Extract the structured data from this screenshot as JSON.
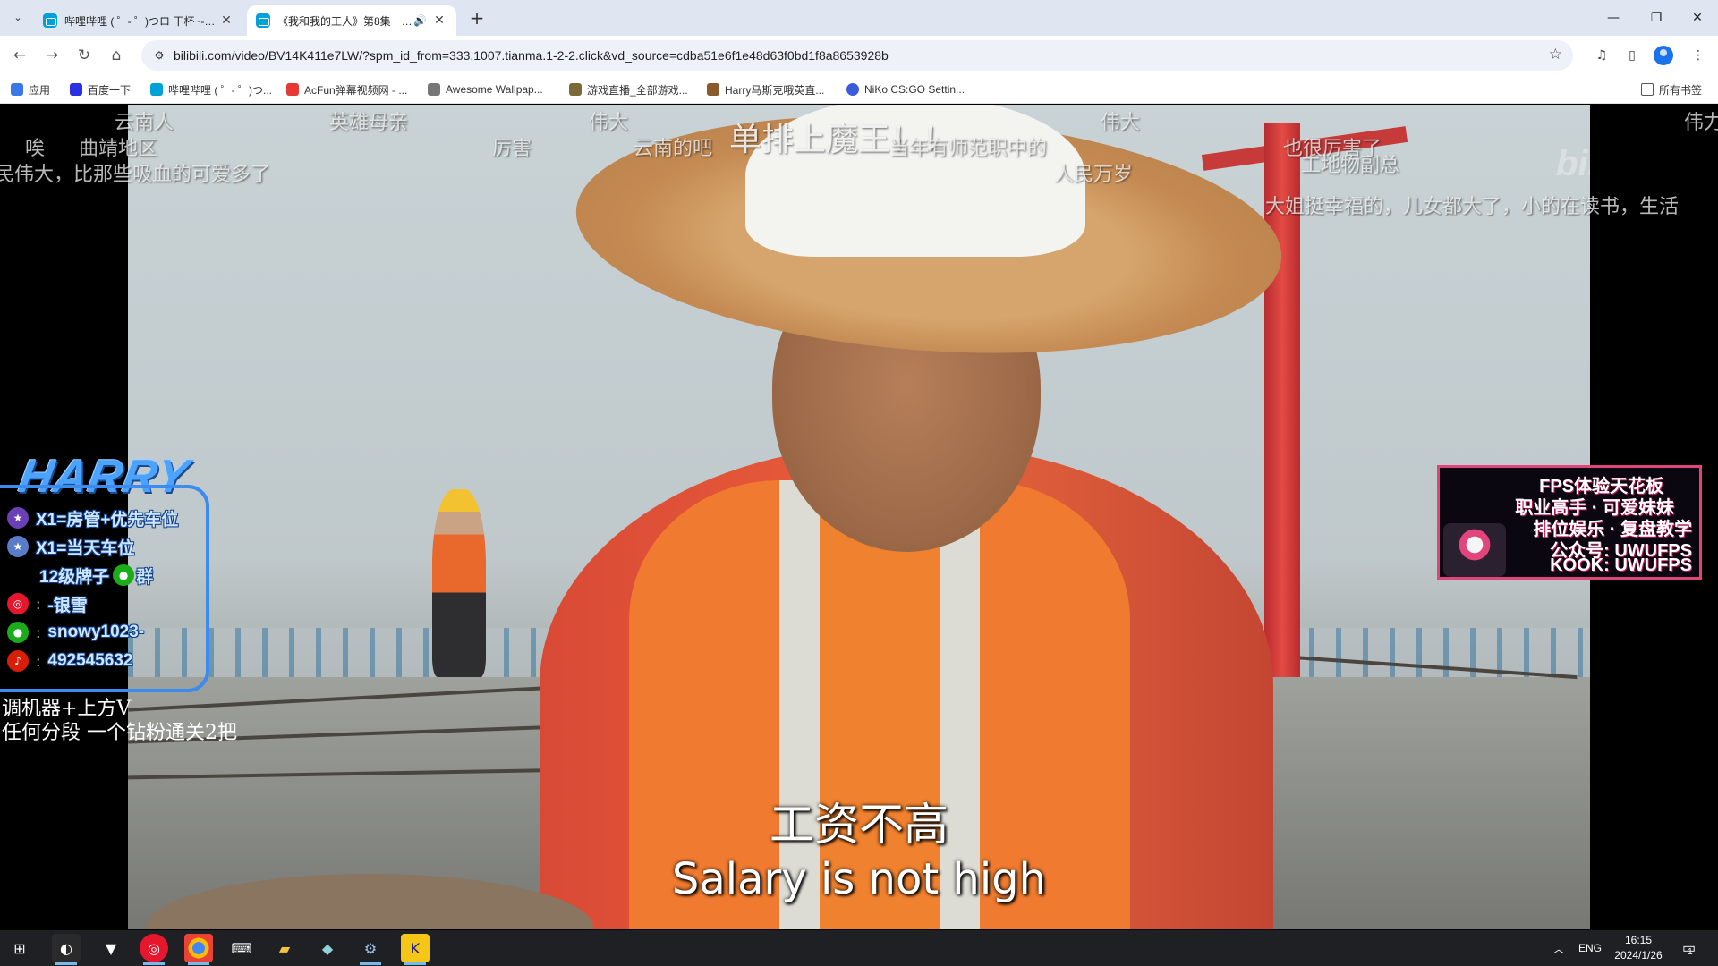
{
  "browser": {
    "tabs": [
      {
        "title": "哔哩哔哩 ( ゜- ゜)つロ 干杯~-bilibili",
        "close": "✕"
      },
      {
        "title": "《我和我的工人》第8集一…",
        "close": "✕",
        "audio": "🔊"
      }
    ],
    "new_tab": "+",
    "window_controls": {
      "minimize": "—",
      "restore": "❐",
      "close": "✕"
    },
    "url": "bilibili.com/video/BV14K411e7LW/?spm_id_from=333.1007.tianma.1-2-2.click&vd_source=cdba51e6f1e48d63f0bd1f8a8653928b",
    "bookmarks": [
      {
        "label": "应用",
        "color": "#3b78e7"
      },
      {
        "label": "百度一下",
        "color": "#2932e1"
      },
      {
        "label": "哔哩哔哩 ( ゜- ゜)つ...",
        "color": "#00a1d6"
      },
      {
        "label": "AcFun弹幕视频网 - ...",
        "color": "#e53935"
      },
      {
        "label": "Awesome Wallpap...",
        "color": "#777777"
      },
      {
        "label": "游戏直播_全部游戏...",
        "color": "#7a6a3a"
      },
      {
        "label": "Harry马斯克哦英直...",
        "color": "#8a5a2a"
      },
      {
        "label": "NiKo CS:GO Settin...",
        "color": "#3b5bdb"
      }
    ],
    "all_bookmarks": "所有书签"
  },
  "video": {
    "danmaku": [
      "云南人",
      "英雄母亲",
      "伟大",
      "伟大",
      "伟力",
      "唉",
      "曲靖地区",
      "厉害",
      "云南的吧",
      "单排上魔王！！",
      "当年有师范职中的",
      "也很厉害了",
      "民伟大，比那些吸血的可爱多了",
      "人民万岁",
      "工地物副总",
      "大姐挺幸福的，儿女都大了，小的在读书，生活"
    ],
    "watermark": "bilibili",
    "subtitle_cn": "工资不高",
    "subtitle_en": "Salary is not high"
  },
  "overlay_left": {
    "logo": "HARRY",
    "rows": [
      {
        "icon": "badge-icon",
        "text": "X1=房管+优先车位",
        "color": "#6b3fb6"
      },
      {
        "icon": "badge-icon",
        "text": "X1=当天车位",
        "color": "#5a7cc8"
      },
      {
        "icon": "wechat-icon",
        "text": "12级牌子",
        "extra": "群",
        "color": "#1aad19"
      },
      {
        "icon": "weibo-icon",
        "text": "-银雪",
        "colon": ":",
        "color": "#e6162d"
      },
      {
        "icon": "wechat-icon",
        "text": "snowy1023-",
        "colon": ":",
        "color": "#1aad19"
      },
      {
        "icon": "douyin-icon",
        "text": "492545632",
        "colon": ":",
        "color": "#d81e06"
      }
    ],
    "notes": [
      "调机器+上方V",
      "任何分段 一个钻粉通关2把"
    ]
  },
  "overlay_right": {
    "lines": [
      "FPS体验天花板",
      "职业高手 · 可爱妹妹",
      "排位娱乐 · 复盘教学",
      "公众号: UWUFPS",
      "KOOK: UWUFPS"
    ]
  },
  "taskbar": {
    "tray_lang": "ENG",
    "time": "16:15",
    "date": "2024/1/26",
    "notification_count": "1"
  }
}
